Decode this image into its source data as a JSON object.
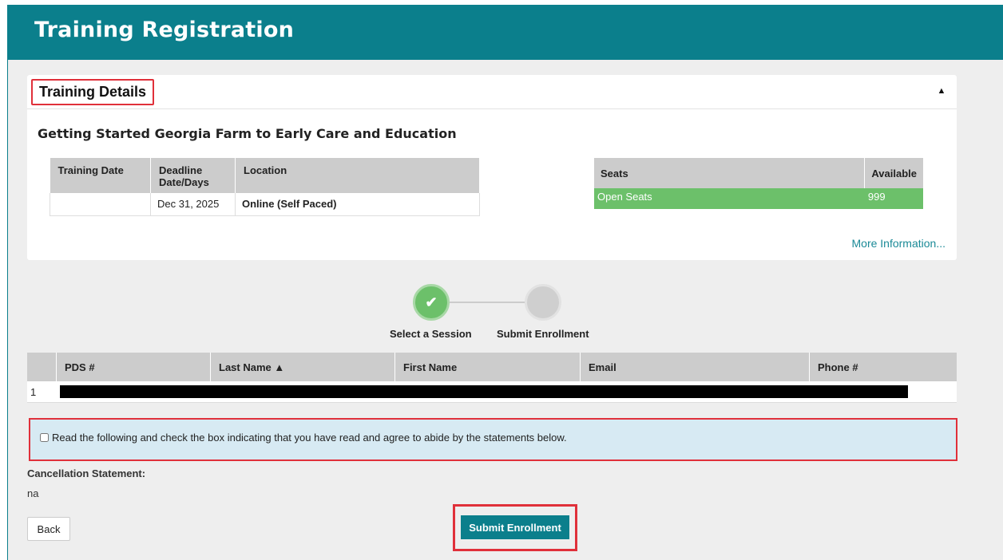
{
  "header": {
    "title": "Training Registration"
  },
  "details_panel": {
    "title": "Training Details",
    "collapse_icon": "caret-up-icon",
    "training_name": "Getting Started Georgia Farm to Early Care and Education",
    "columns": [
      "Training Date",
      "Deadline Date/Days",
      "Location"
    ],
    "row": {
      "training_date": "",
      "deadline": "Dec 31, 2025",
      "location": "Online (Self Paced)"
    },
    "seats": {
      "columns": [
        "Seats",
        "Available"
      ],
      "row": {
        "type": "Open Seats",
        "available": "999"
      },
      "color": "#6cc06a"
    },
    "more_info_label": "More Information..."
  },
  "stepper": {
    "steps": [
      {
        "label": "Select a Session",
        "status": "complete",
        "icon": "check-icon"
      },
      {
        "label": "Submit Enrollment",
        "status": "pending"
      }
    ]
  },
  "people_table": {
    "columns": [
      "",
      "PDS #",
      "Last Name ▲",
      "First Name",
      "Email",
      "Phone #"
    ],
    "rows": [
      {
        "index": "1",
        "redacted": true
      }
    ]
  },
  "agreement": {
    "checked": false,
    "text": "Read the following and check the box indicating that you have read and agree to abide by the statements below."
  },
  "cancellation": {
    "label": "Cancellation Statement:",
    "value": "na"
  },
  "buttons": {
    "back": "Back",
    "submit": "Submit Enrollment"
  },
  "colors": {
    "brand": "#0b7f8c",
    "highlight": "#e0303a",
    "success": "#6cc06a"
  }
}
